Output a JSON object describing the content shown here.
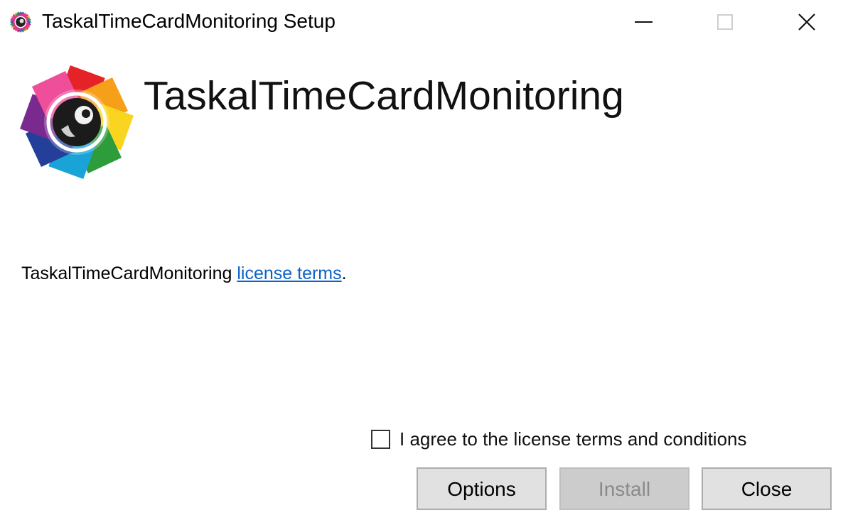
{
  "window": {
    "title": "TaskalTimeCardMonitoring Setup",
    "controls": [
      "minimize",
      "maximize",
      "close"
    ]
  },
  "header": {
    "product_name": "TaskalTimeCardMonitoring",
    "logo_icon": "camera-aperture-logo-icon"
  },
  "license": {
    "prefix": "TaskalTimeCardMonitoring ",
    "link_text": "license terms",
    "suffix": "."
  },
  "agreement": {
    "label": "I agree to the license terms and conditions",
    "checked": false
  },
  "buttons": {
    "options": "Options",
    "install": "Install",
    "close": "Close",
    "install_enabled": false
  },
  "colors": {
    "link": "#0b62c7",
    "button_face": "#e1e1e1",
    "button_disabled": "#cccccc"
  }
}
